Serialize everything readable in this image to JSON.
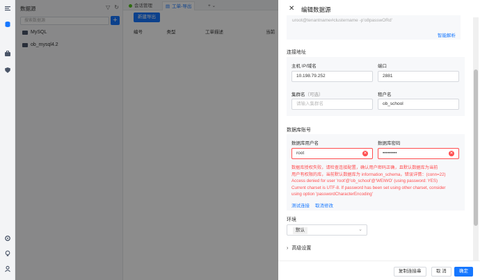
{
  "rail": {
    "icons": [
      "menu-icon",
      "database-icon",
      "briefcase-icon",
      "shield-icon",
      "settings-icon",
      "lightbulb-icon",
      "user-icon"
    ]
  },
  "left_panel": {
    "title": "数据源",
    "search_placeholder": "搜索数据源",
    "add_label": "+",
    "items": [
      {
        "label": "MySQL"
      },
      {
        "label": "ob_mysql4.2"
      }
    ]
  },
  "tabs": [
    {
      "label": "会话管理"
    },
    {
      "label": "工单-导出"
    }
  ],
  "new_tab_label": "+ ⌄",
  "toolbar": {
    "new_export_label": "新建导出"
  },
  "table": {
    "columns": [
      "编号",
      "类型",
      "工单描述",
      "当前"
    ]
  },
  "drawer": {
    "title": "编辑数据源",
    "conn_string_placeholder": "uroot@tenantname#clustername -p'o8passwORd'",
    "smart_parse_label": "智能解析",
    "connection_section": "连接地址",
    "host_label": "主机 IP/域名",
    "host_value": "10.198.79.252",
    "port_label": "端口",
    "port_value": "2881",
    "cluster_label": "集群名",
    "cluster_optional": "（可选）",
    "cluster_placeholder": "请输入集群名",
    "tenant_label": "租户名",
    "tenant_value": "ob_school",
    "account_section": "数据库账号",
    "username_label": "数据库用户名",
    "username_value": "root",
    "password_label": "数据库密码",
    "password_value": "•••••••••",
    "error_lines": [
      "数据库授权失败，请检查连接配置，确认用户密码正确，且默认数据库为当前",
      "用户有权限的库，当前默认数据库为 information_schema，错误详情：(conn=22)",
      "Access denied for user 'root'@'ob_school'@'WEIWO' (using password: YES)",
      "Current charset is UTF-8. If password has been set using other charset, consider",
      "using option 'passwordCharacterEncoding'"
    ],
    "test_connection_label": "测试连接",
    "cancel_edit_label": "取消修改",
    "env_section": "环境",
    "env_value": "默认",
    "advanced_label": "高级设置",
    "copy_conn_label": "复制连接串",
    "cancel_label": "取 消",
    "confirm_label": "确定"
  },
  "colors": {
    "primary": "#1677ff",
    "error": "#ff4d4f"
  }
}
